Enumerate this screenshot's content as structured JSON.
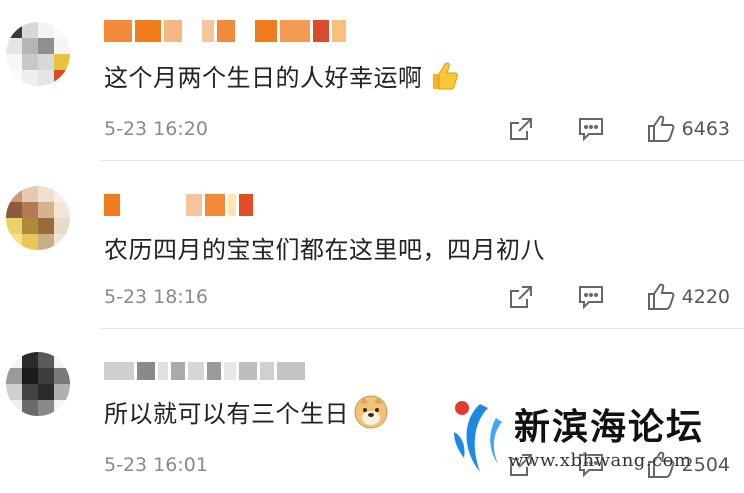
{
  "comments": [
    {
      "text": "这个月两个生日的人好幸运啊",
      "emoji": "thumbs-up-emoji",
      "time": "5-23 16:20",
      "likes": "6463"
    },
    {
      "text": "农历四月的宝宝们都在这里吧，四月初八",
      "time": "5-23 18:16",
      "likes": "4220"
    },
    {
      "text": "所以就可以有三个生日",
      "emoji": "doge-emoji",
      "time": "5-23 16:01",
      "likes": "2504"
    }
  ],
  "watermark": {
    "title": "新滨海论坛",
    "url": "www.xbhwang.com"
  },
  "icons": {
    "share": "share-icon",
    "reply": "comment-icon",
    "like": "thumbs-up-icon"
  },
  "colors": {
    "text": "#222222",
    "meta": "#8a8a8a",
    "icon": "#666666",
    "username_accent": "#f07c1e",
    "logo_blue": "#1e88e5",
    "logo_red": "#e53935"
  }
}
